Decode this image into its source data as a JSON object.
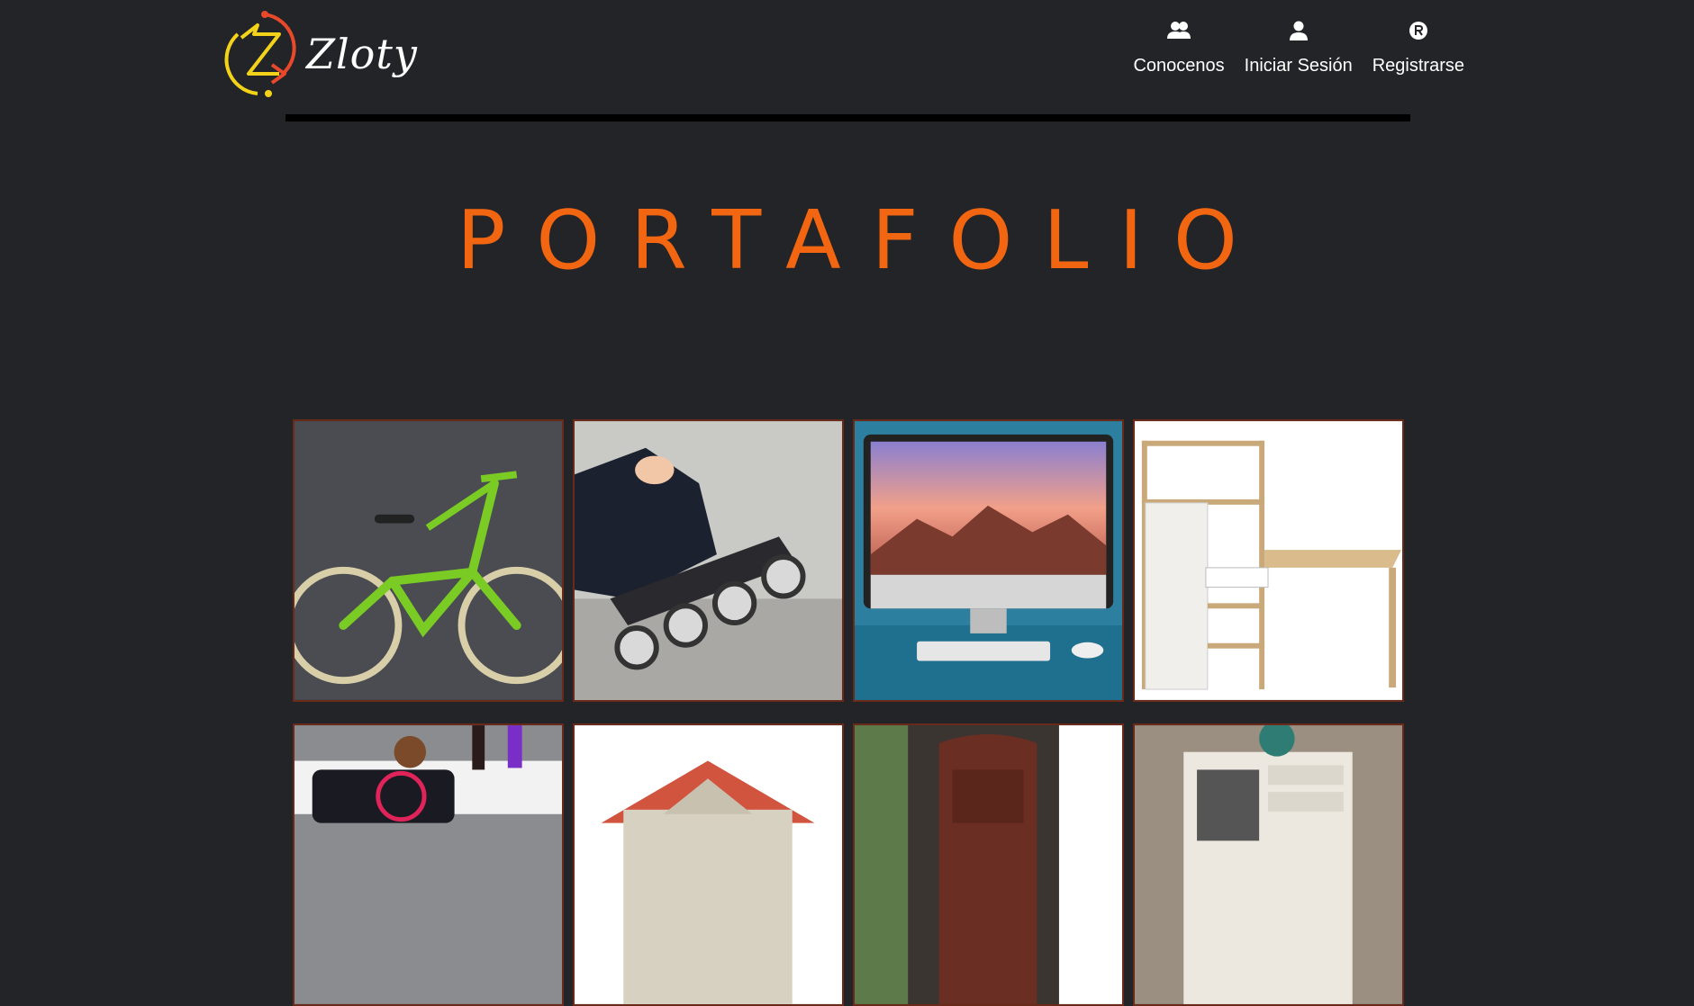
{
  "brand": {
    "name": "Zloty",
    "logo_icon": "zloty-logo-icon"
  },
  "nav": {
    "items": [
      {
        "label": "Conocenos",
        "icon": "users-icon"
      },
      {
        "label": "Iniciar Sesión",
        "icon": "user-icon"
      },
      {
        "label": "Registrarse",
        "icon": "registered-icon"
      }
    ]
  },
  "page": {
    "title": "PORTAFOLIO"
  },
  "gallery": {
    "items": [
      {
        "subject": "bmx-bike"
      },
      {
        "subject": "inline-skates"
      },
      {
        "subject": "imac-computer"
      },
      {
        "subject": "wooden-desk"
      },
      {
        "subject": "speaker-with-toy"
      },
      {
        "subject": "dog-house"
      },
      {
        "subject": "wooden-door"
      },
      {
        "subject": "white-dresser"
      }
    ]
  },
  "colors": {
    "accent": "#f26511",
    "background": "#232428",
    "card_border": "#6a2a1a"
  }
}
